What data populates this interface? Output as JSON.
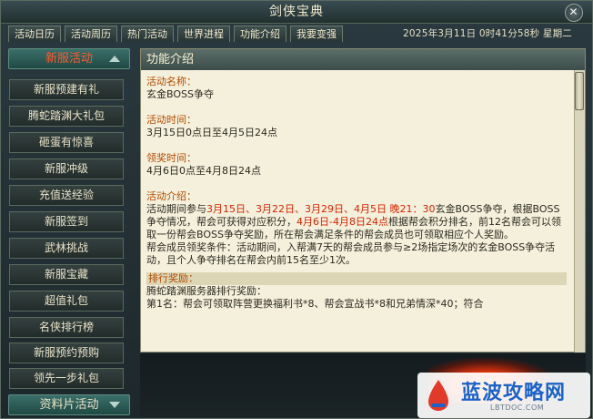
{
  "window": {
    "title": "剑侠宝典",
    "close_symbol": "✕"
  },
  "tabs": [
    "活动日历",
    "活动周历",
    "热门活动",
    "世界进程",
    "功能介绍",
    "我要变强"
  ],
  "datetime": "2025年3月11日  0时41分58秒  星期二",
  "sidebar": {
    "active_category": "新服活动",
    "items": [
      "新服预建有礼",
      "腾蛇踏渊大礼包",
      "砸蛋有惊喜",
      "新服冲级",
      "充值送经验",
      "新服签到",
      "武林挑战",
      "新服宝藏",
      "超值礼包",
      "名侠排行榜",
      "新服预约预购",
      "领先一步礼包"
    ],
    "bottom_category": "资料片活动"
  },
  "content": {
    "header": "功能介绍",
    "name_label": "活动名称：",
    "name_value": "玄金BOSS争夺",
    "time_label": "活动时间：",
    "time_value": "3月15日0点日至4月5日24点",
    "reward_time_label": "领奖时间：",
    "reward_time_value": "4月6日0点至4月8日24点",
    "intro_label": "活动介绍：",
    "intro_p1_a": "活动期间参与",
    "intro_p1_dates": "3月15日、3月22日、3月29日、4月5日 晚21：30",
    "intro_p1_b": "玄金BOSS争夺，根据BOSS争夺情况，帮会可获得对应积分，",
    "intro_p1_dates2": "4月6日-4月8日24点",
    "intro_p1_c": "根据帮会积分排名，前12名帮会可以领取一份帮会BOSS争夺奖励，所在帮会满足条件的帮会成员也可领取相应个人奖励。",
    "intro_p2": "帮会成员领奖条件：活动期间，入帮满7天的帮会成员参与≥2场指定场次的玄金BOSS争夺活动，且个人争夺排名在帮会内前15名至少1次。",
    "rank_label": "排行奖励：",
    "rank_line1": "腾蛇踏渊服务器排行奖励：",
    "rank_line2": "第1名：帮会可领取阵营更换福利书*8、帮会宣战书*8和兄弟情深*40；符合"
  },
  "watermark": {
    "title": "蓝波攻略网",
    "url": "LBTDOC.COM"
  }
}
